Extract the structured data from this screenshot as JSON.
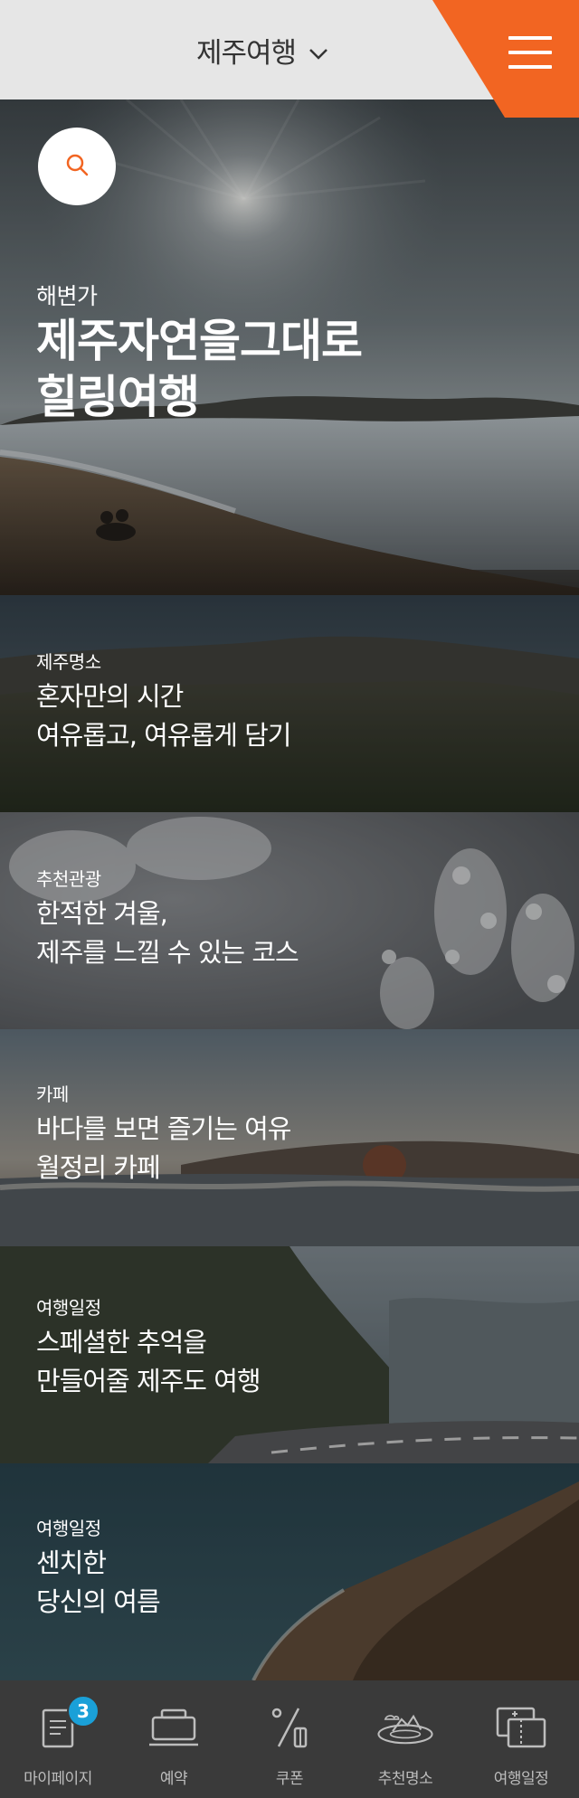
{
  "header": {
    "title": "제주여행",
    "accent_color": "#f26522"
  },
  "hero": {
    "category": "해변가",
    "title_line1": "제주자연을그대로",
    "title_line2": "힐링여행"
  },
  "sections": [
    {
      "category": "제주명소",
      "line1": "혼자만의 시간",
      "line2": "여유롭고, 여유롭게 담기"
    },
    {
      "category": "추천관광",
      "line1": "한적한 겨울,",
      "line2": "제주를 느낄 수 있는 코스"
    },
    {
      "category": "카페",
      "line1": "바다를 보면 즐기는 여유",
      "line2": "월정리 카페"
    },
    {
      "category": "여행일정",
      "line1": "스페셜한 추억을",
      "line2": "만들어줄 제주도 여행"
    },
    {
      "category": "여행일정",
      "line1": "센치한",
      "line2": "당신의 여름"
    }
  ],
  "bottom_nav": {
    "items": [
      {
        "label": "마이페이지",
        "icon": "document-icon",
        "badge": "3"
      },
      {
        "label": "예약",
        "icon": "reservation-icon"
      },
      {
        "label": "쿠폰",
        "icon": "coupon-icon"
      },
      {
        "label": "추천명소",
        "icon": "landmark-icon"
      },
      {
        "label": "여행일정",
        "icon": "ticket-icon"
      }
    ]
  }
}
